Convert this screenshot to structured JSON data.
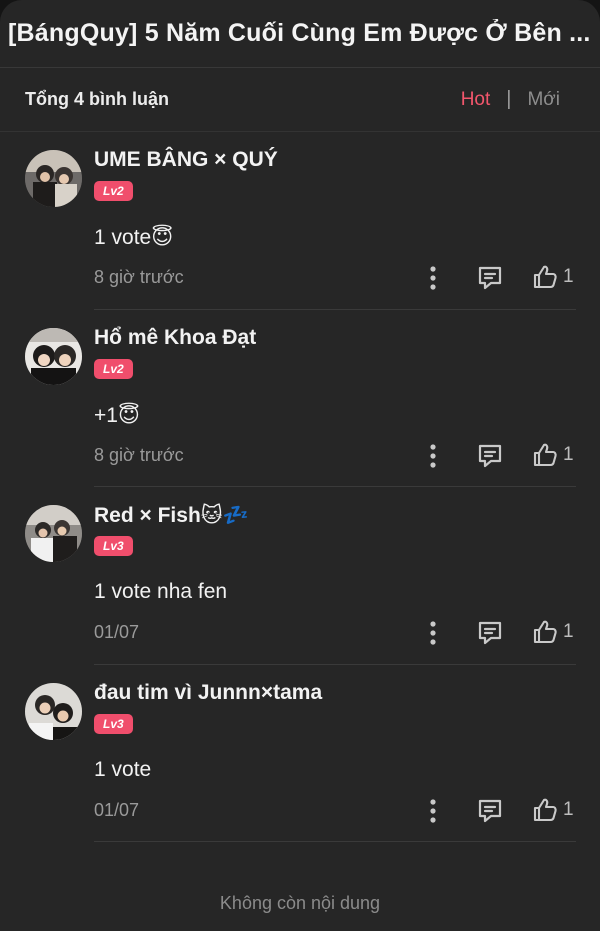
{
  "header": {
    "title": "[BángQuy] 5 Năm Cuối Cùng Em Được Ở Bên ..."
  },
  "summary": {
    "total_label": "Tổng 4 bình luận",
    "sort_hot": "Hot",
    "sort_separator": "|",
    "sort_new": "Mới"
  },
  "comments": [
    {
      "username": "UME BÂNG × QUÝ",
      "level": "Lv2",
      "content": "1 vote😇",
      "time": "8 giờ trước",
      "likes": "1"
    },
    {
      "username": "Hổ mê Khoa Đạt",
      "level": "Lv2",
      "content": "+1😇",
      "time": "8 giờ trước",
      "likes": "1"
    },
    {
      "username": "Red × Fish🐱💤",
      "level": "Lv3",
      "content": "1 vote nha fen",
      "time": "01/07",
      "likes": "1"
    },
    {
      "username": "đau tim vì Junnn×tama",
      "level": "Lv3",
      "content": "1 vote",
      "time": "01/07",
      "likes": "1"
    }
  ],
  "footer": {
    "end_label": "Không còn nội dung"
  },
  "icons": {
    "more": "more-vertical-icon",
    "reply": "comment-bubble-icon",
    "like": "thumbs-up-icon"
  },
  "colors": {
    "background": "#262626",
    "accent": "#f2566c",
    "level_badge": "#f04e6c",
    "text_primary": "#f2f2f2",
    "text_secondary": "#9a9a9a"
  }
}
